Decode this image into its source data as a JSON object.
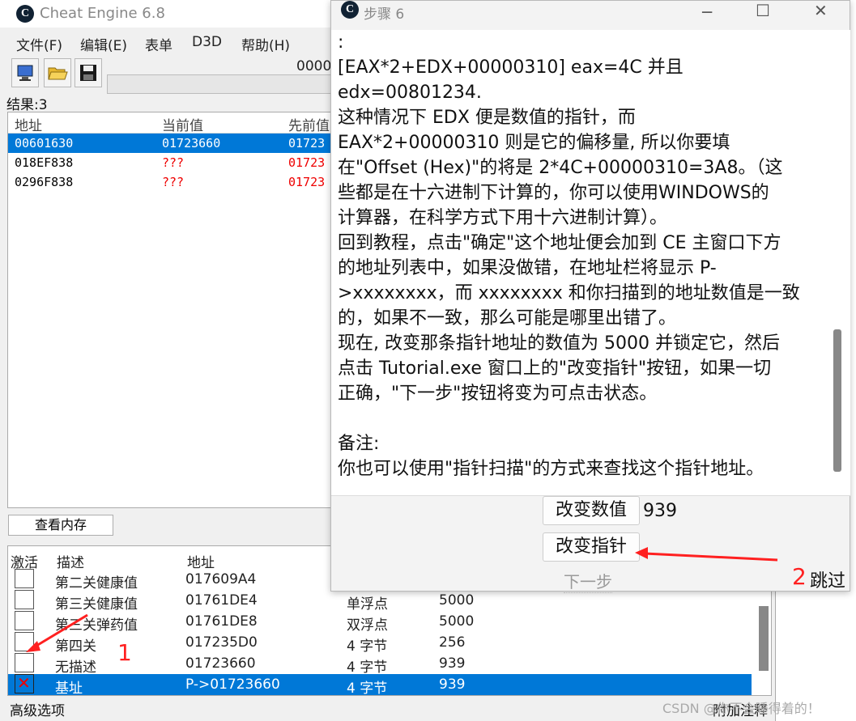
{
  "main_window": {
    "title": "Cheat Engine 6.8",
    "menu": [
      "文件(F)",
      "编辑(E)",
      "表单",
      "D3D",
      "帮助(H)"
    ],
    "address_value": "0000",
    "result_label": "结果:3",
    "results": {
      "headers": [
        "地址",
        "当前值",
        "先前值"
      ],
      "rows": [
        {
          "address": "00601630",
          "current": "01723660",
          "previous": "01723"
        },
        {
          "address": "018EF838",
          "current": "???",
          "previous": "01723"
        },
        {
          "address": "0296F838",
          "current": "???",
          "previous": "01723"
        }
      ]
    },
    "view_memory_button": "查看内存",
    "cheat_table": {
      "headers": [
        "激活",
        "描述",
        "地址"
      ],
      "rows": [
        {
          "desc": "第二关健康值",
          "address": "017609A4",
          "type": "",
          "value": ""
        },
        {
          "desc": "第三关健康值",
          "address": "01761DE4",
          "type": "单浮点",
          "value": "5000"
        },
        {
          "desc": "第三关弹药值",
          "address": "01761DE8",
          "type": "双浮点",
          "value": "5000"
        },
        {
          "desc": "第四关",
          "address": "017235D0",
          "type": "4 字节",
          "value": "256"
        },
        {
          "desc": "无描述",
          "address": "01723660",
          "type": "4 字节",
          "value": "939"
        },
        {
          "desc": "基址",
          "address": "P->01723660",
          "type": "4 字节",
          "value": "939"
        }
      ]
    },
    "status_left": "高级选项",
    "status_right": "附加注释"
  },
  "dialog": {
    "title": "步骤 6",
    "lines": [
      ":",
      "[EAX*2+EDX+00000310] eax=4C 并且",
      "edx=00801234.",
      "这种情况下 EDX 便是数值的指针，而",
      "EAX*2+00000310 则是它的偏移量, 所以你要填",
      "在\"Offset (Hex)\"的将是 2*4C+00000310=3A8。（这",
      "些都是在十六进制下计算的，你可以使用WINDOWS的",
      "计算器，在科学方式下用十六进制计算）。",
      "回到教程，点击\"确定\"这个地址便会加到 CE 主窗口下方",
      "的地址列表中，如果没做错，在地址栏将显示 P-",
      ">xxxxxxxx，而 xxxxxxxx 和你扫描到的地址数值是一致",
      "的，如果不一致，那么可能是哪里出错了。",
      "现在, 改变那条指针地址的数值为 5000 并锁定它，然后",
      "点击 Tutorial.exe 窗口上的\"改变指针\"按钮，如果一切",
      "正确，\"下一步\"按钮将变为可点击状态。",
      "",
      "备注:",
      "你也可以使用\"指针扫描\"的方式来查找这个指针地址。"
    ],
    "change_value_button": "改变数值",
    "change_value_number": "939",
    "change_pointer_button": "改变指针",
    "next_button": "下一步"
  },
  "annotations": {
    "label_1": "1",
    "label_2": "2",
    "skip_text": "跳过",
    "color": "#ff2020"
  },
  "watermark": "CSDN @你不会睡得着的！"
}
